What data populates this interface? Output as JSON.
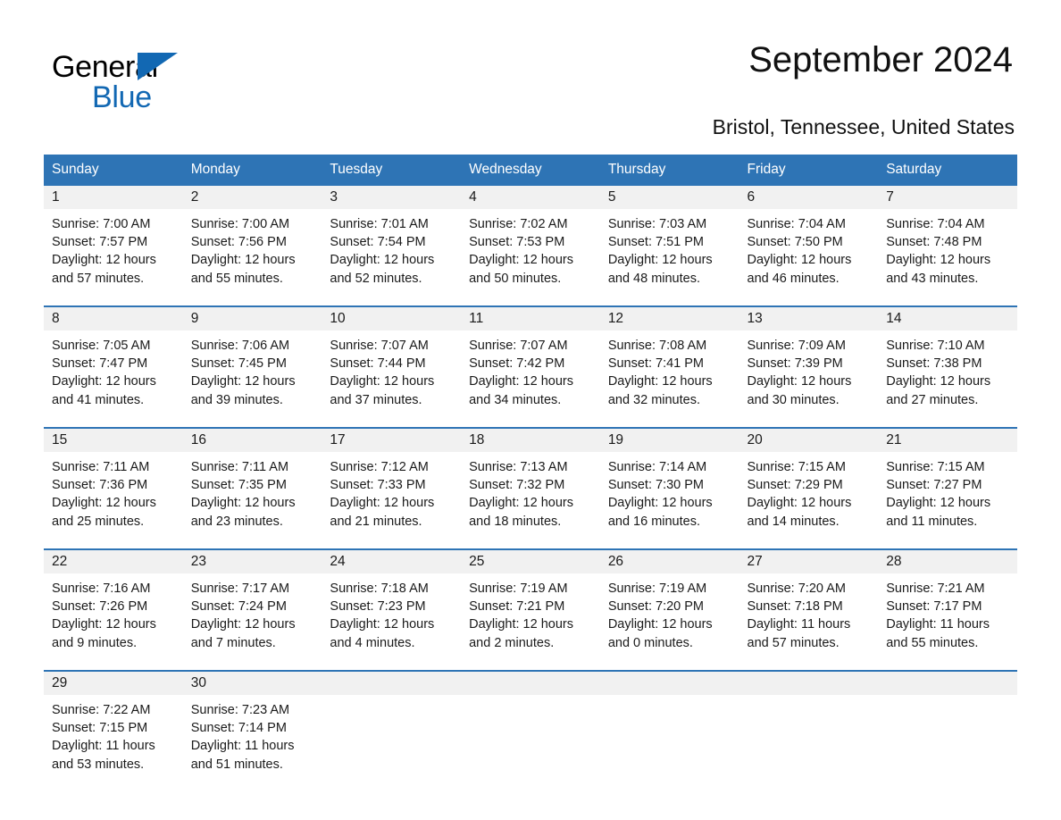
{
  "brand": {
    "name_part1": "General",
    "name_part2": "Blue",
    "accent_color": "#1268b3"
  },
  "header": {
    "title": "September 2024",
    "subtitle": "Bristol, Tennessee, United States"
  },
  "theme": {
    "header_blue": "#2e74b5",
    "daynum_band": "#f1f1f1",
    "text": "#1a1a1a"
  },
  "calendar": {
    "weekday_headers": [
      "Sunday",
      "Monday",
      "Tuesday",
      "Wednesday",
      "Thursday",
      "Friday",
      "Saturday"
    ],
    "weeks": [
      [
        {
          "day": "1",
          "sunrise": "Sunrise: 7:00 AM",
          "sunset": "Sunset: 7:57 PM",
          "daylight": "Daylight: 12 hours and 57 minutes."
        },
        {
          "day": "2",
          "sunrise": "Sunrise: 7:00 AM",
          "sunset": "Sunset: 7:56 PM",
          "daylight": "Daylight: 12 hours and 55 minutes."
        },
        {
          "day": "3",
          "sunrise": "Sunrise: 7:01 AM",
          "sunset": "Sunset: 7:54 PM",
          "daylight": "Daylight: 12 hours and 52 minutes."
        },
        {
          "day": "4",
          "sunrise": "Sunrise: 7:02 AM",
          "sunset": "Sunset: 7:53 PM",
          "daylight": "Daylight: 12 hours and 50 minutes."
        },
        {
          "day": "5",
          "sunrise": "Sunrise: 7:03 AM",
          "sunset": "Sunset: 7:51 PM",
          "daylight": "Daylight: 12 hours and 48 minutes."
        },
        {
          "day": "6",
          "sunrise": "Sunrise: 7:04 AM",
          "sunset": "Sunset: 7:50 PM",
          "daylight": "Daylight: 12 hours and 46 minutes."
        },
        {
          "day": "7",
          "sunrise": "Sunrise: 7:04 AM",
          "sunset": "Sunset: 7:48 PM",
          "daylight": "Daylight: 12 hours and 43 minutes."
        }
      ],
      [
        {
          "day": "8",
          "sunrise": "Sunrise: 7:05 AM",
          "sunset": "Sunset: 7:47 PM",
          "daylight": "Daylight: 12 hours and 41 minutes."
        },
        {
          "day": "9",
          "sunrise": "Sunrise: 7:06 AM",
          "sunset": "Sunset: 7:45 PM",
          "daylight": "Daylight: 12 hours and 39 minutes."
        },
        {
          "day": "10",
          "sunrise": "Sunrise: 7:07 AM",
          "sunset": "Sunset: 7:44 PM",
          "daylight": "Daylight: 12 hours and 37 minutes."
        },
        {
          "day": "11",
          "sunrise": "Sunrise: 7:07 AM",
          "sunset": "Sunset: 7:42 PM",
          "daylight": "Daylight: 12 hours and 34 minutes."
        },
        {
          "day": "12",
          "sunrise": "Sunrise: 7:08 AM",
          "sunset": "Sunset: 7:41 PM",
          "daylight": "Daylight: 12 hours and 32 minutes."
        },
        {
          "day": "13",
          "sunrise": "Sunrise: 7:09 AM",
          "sunset": "Sunset: 7:39 PM",
          "daylight": "Daylight: 12 hours and 30 minutes."
        },
        {
          "day": "14",
          "sunrise": "Sunrise: 7:10 AM",
          "sunset": "Sunset: 7:38 PM",
          "daylight": "Daylight: 12 hours and 27 minutes."
        }
      ],
      [
        {
          "day": "15",
          "sunrise": "Sunrise: 7:11 AM",
          "sunset": "Sunset: 7:36 PM",
          "daylight": "Daylight: 12 hours and 25 minutes."
        },
        {
          "day": "16",
          "sunrise": "Sunrise: 7:11 AM",
          "sunset": "Sunset: 7:35 PM",
          "daylight": "Daylight: 12 hours and 23 minutes."
        },
        {
          "day": "17",
          "sunrise": "Sunrise: 7:12 AM",
          "sunset": "Sunset: 7:33 PM",
          "daylight": "Daylight: 12 hours and 21 minutes."
        },
        {
          "day": "18",
          "sunrise": "Sunrise: 7:13 AM",
          "sunset": "Sunset: 7:32 PM",
          "daylight": "Daylight: 12 hours and 18 minutes."
        },
        {
          "day": "19",
          "sunrise": "Sunrise: 7:14 AM",
          "sunset": "Sunset: 7:30 PM",
          "daylight": "Daylight: 12 hours and 16 minutes."
        },
        {
          "day": "20",
          "sunrise": "Sunrise: 7:15 AM",
          "sunset": "Sunset: 7:29 PM",
          "daylight": "Daylight: 12 hours and 14 minutes."
        },
        {
          "day": "21",
          "sunrise": "Sunrise: 7:15 AM",
          "sunset": "Sunset: 7:27 PM",
          "daylight": "Daylight: 12 hours and 11 minutes."
        }
      ],
      [
        {
          "day": "22",
          "sunrise": "Sunrise: 7:16 AM",
          "sunset": "Sunset: 7:26 PM",
          "daylight": "Daylight: 12 hours and 9 minutes."
        },
        {
          "day": "23",
          "sunrise": "Sunrise: 7:17 AM",
          "sunset": "Sunset: 7:24 PM",
          "daylight": "Daylight: 12 hours and 7 minutes."
        },
        {
          "day": "24",
          "sunrise": "Sunrise: 7:18 AM",
          "sunset": "Sunset: 7:23 PM",
          "daylight": "Daylight: 12 hours and 4 minutes."
        },
        {
          "day": "25",
          "sunrise": "Sunrise: 7:19 AM",
          "sunset": "Sunset: 7:21 PM",
          "daylight": "Daylight: 12 hours and 2 minutes."
        },
        {
          "day": "26",
          "sunrise": "Sunrise: 7:19 AM",
          "sunset": "Sunset: 7:20 PM",
          "daylight": "Daylight: 12 hours and 0 minutes."
        },
        {
          "day": "27",
          "sunrise": "Sunrise: 7:20 AM",
          "sunset": "Sunset: 7:18 PM",
          "daylight": "Daylight: 11 hours and 57 minutes."
        },
        {
          "day": "28",
          "sunrise": "Sunrise: 7:21 AM",
          "sunset": "Sunset: 7:17 PM",
          "daylight": "Daylight: 11 hours and 55 minutes."
        }
      ],
      [
        {
          "day": "29",
          "sunrise": "Sunrise: 7:22 AM",
          "sunset": "Sunset: 7:15 PM",
          "daylight": "Daylight: 11 hours and 53 minutes."
        },
        {
          "day": "30",
          "sunrise": "Sunrise: 7:23 AM",
          "sunset": "Sunset: 7:14 PM",
          "daylight": "Daylight: 11 hours and 51 minutes."
        },
        {
          "day": "",
          "sunrise": "",
          "sunset": "",
          "daylight": ""
        },
        {
          "day": "",
          "sunrise": "",
          "sunset": "",
          "daylight": ""
        },
        {
          "day": "",
          "sunrise": "",
          "sunset": "",
          "daylight": ""
        },
        {
          "day": "",
          "sunrise": "",
          "sunset": "",
          "daylight": ""
        },
        {
          "day": "",
          "sunrise": "",
          "sunset": "",
          "daylight": ""
        }
      ]
    ]
  }
}
